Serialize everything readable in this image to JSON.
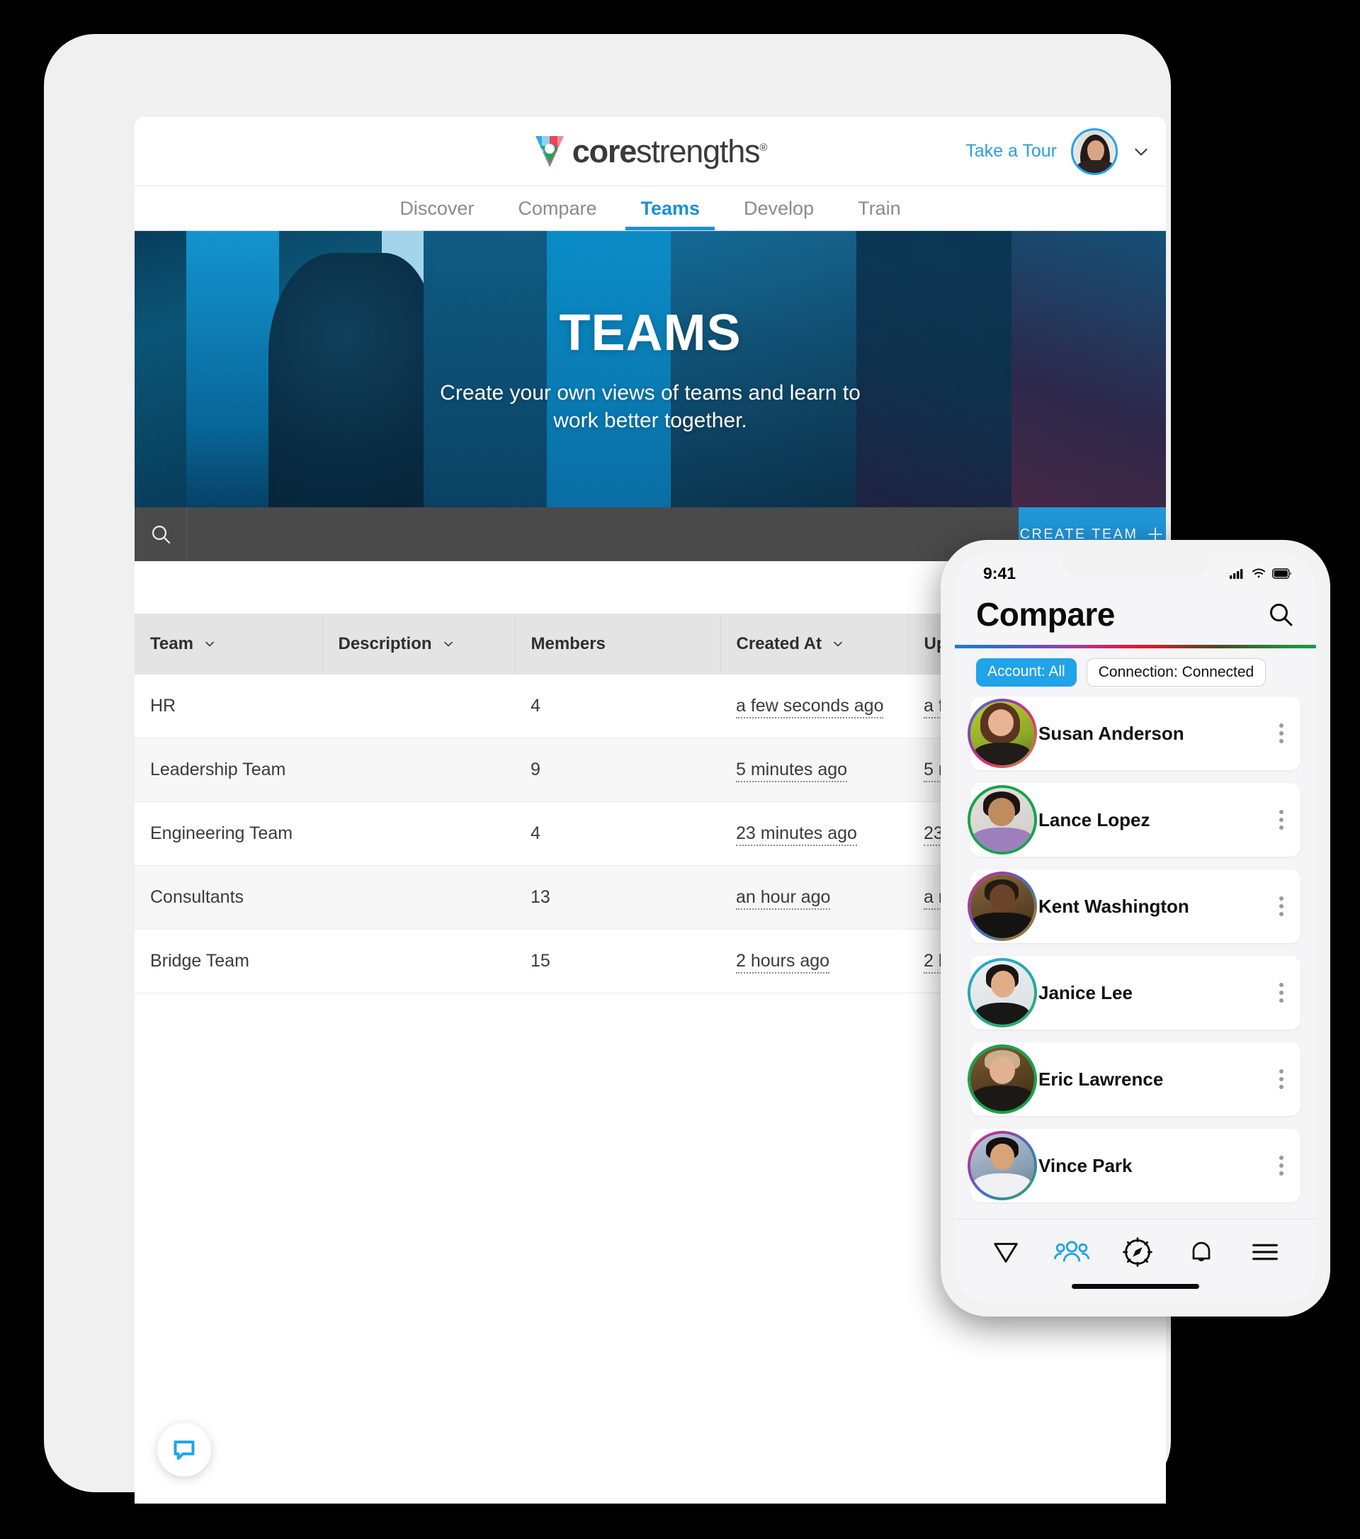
{
  "tablet": {
    "header": {
      "logo_text_bold": "core",
      "logo_text_thin": "strengths",
      "logo_registered": "®",
      "take_tour_label": "Take a Tour",
      "avatar_name": "user-avatar",
      "chevron": "chevron-down-icon"
    },
    "nav": {
      "items": [
        {
          "label": "Discover",
          "active": false
        },
        {
          "label": "Compare",
          "active": false
        },
        {
          "label": "Teams",
          "active": true
        },
        {
          "label": "Develop",
          "active": false
        },
        {
          "label": "Train",
          "active": false
        }
      ]
    },
    "hero": {
      "title": "TEAMS",
      "subtitle": "Create your own views of teams and learn to work better together."
    },
    "action_bar": {
      "search_icon": "search-icon",
      "search_value": "",
      "search_placeholder": "",
      "create_team_label": "CREATE TEAM",
      "create_team_plus": "+"
    },
    "table": {
      "columns": [
        {
          "label": "Team",
          "sortable": true
        },
        {
          "label": "Description",
          "sortable": true
        },
        {
          "label": "Members",
          "sortable": false
        },
        {
          "label": "Created At",
          "sortable": true
        },
        {
          "label": "Updated At",
          "sortable": true
        }
      ],
      "rows": [
        {
          "team": "HR",
          "description": "",
          "members": "4",
          "created_at": "a few seconds ago",
          "updated_at": "a few seconds ago"
        },
        {
          "team": "Leadership Team",
          "description": "",
          "members": "9",
          "created_at": "5 minutes ago",
          "updated_at": "5 minutes ago"
        },
        {
          "team": "Engineering Team",
          "description": "",
          "members": "4",
          "created_at": "23 minutes ago",
          "updated_at": "23 minutes ago"
        },
        {
          "team": "Consultants",
          "description": "",
          "members": "13",
          "created_at": "an hour ago",
          "updated_at": "a minute ago"
        },
        {
          "team": "Bridge Team",
          "description": "",
          "members": "15",
          "created_at": "2 hours ago",
          "updated_at": "2 hours ago"
        }
      ]
    },
    "chat_widget": {
      "icon": "chat-bubble-icon"
    }
  },
  "phone": {
    "status_bar": {
      "time": "9:41",
      "signal": "cellular-signal-icon",
      "wifi": "wifi-icon",
      "battery": "battery-full-icon"
    },
    "title": "Compare",
    "search_icon": "search-icon",
    "chips": [
      {
        "label": "Account: All",
        "style": "filled"
      },
      {
        "label": "Connection: Connected",
        "style": "outline"
      }
    ],
    "people": [
      {
        "name": "Susan Anderson",
        "ring": "gradient-pink"
      },
      {
        "name": "Lance Lopez",
        "ring": "green"
      },
      {
        "name": "Kent Washington",
        "ring": "gradient-pink"
      },
      {
        "name": "Janice Lee",
        "ring": "gradient-teal"
      },
      {
        "name": "Eric Lawrence",
        "ring": "green"
      },
      {
        "name": "Vince Park",
        "ring": "gradient-pink"
      }
    ],
    "nav_items": [
      {
        "icon": "triangle-down-icon",
        "active": false
      },
      {
        "icon": "people-group-icon",
        "active": true
      },
      {
        "icon": "compass-icon",
        "active": false
      },
      {
        "icon": "bell-icon",
        "active": false
      },
      {
        "icon": "hamburger-menu-icon",
        "active": false
      }
    ]
  },
  "colors": {
    "accent_blue": "#2196d8",
    "nav_active": "#1c8fd6",
    "link_blue": "#2a9fe0",
    "chip_blue": "#21a3e8",
    "bar_dark": "#4a4a4a",
    "table_header": "#e4e4e4"
  }
}
